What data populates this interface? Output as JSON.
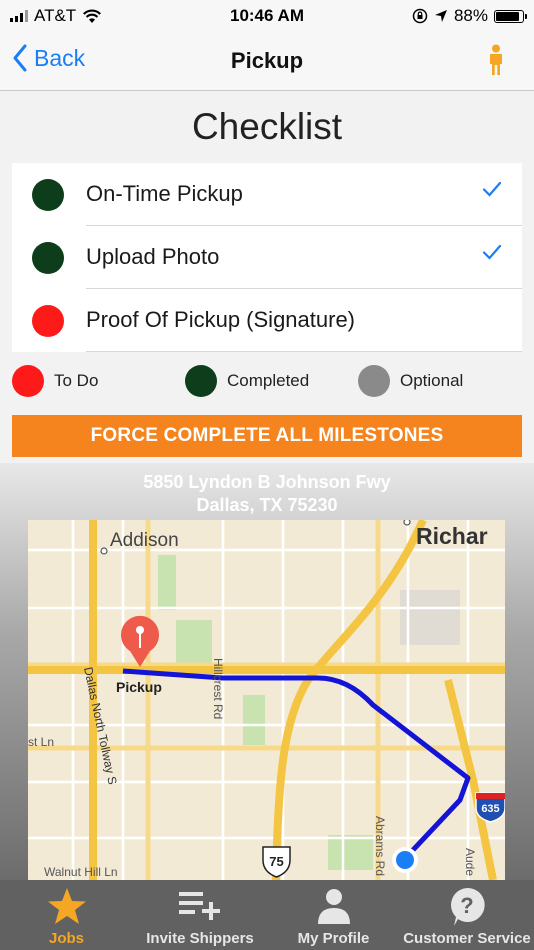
{
  "status": {
    "carrier": "AT&T",
    "time": "10:46 AM",
    "battery": "88%",
    "battery_level": 0.88
  },
  "nav": {
    "back_label": "Back",
    "title": "Pickup"
  },
  "checklist": {
    "title": "Checklist",
    "items": [
      {
        "label": "On-Time Pickup",
        "status_color": "#0d3d1b",
        "checked": true
      },
      {
        "label": "Upload Photo",
        "status_color": "#0d3d1b",
        "checked": true
      },
      {
        "label": "Proof Of Pickup (Signature)",
        "status_color": "#ff1a1a",
        "checked": false
      }
    ]
  },
  "legend": [
    {
      "label": "To Do",
      "color": "#ff1a1a"
    },
    {
      "label": "Completed",
      "color": "#0d3d1b"
    },
    {
      "label": "Optional",
      "color": "#8a8a8a"
    }
  ],
  "force_button": "FORCE COMPLETE ALL MILESTONES",
  "address": {
    "line1": "5850 Lyndon B Johnson Fwy",
    "line2": "Dallas, TX 75230"
  },
  "map": {
    "labels": {
      "addison": "Addison",
      "richardson": "Richar",
      "pickup": "Pickup",
      "tollway": "Dallas North Tollway S",
      "hillcrest": "Hillcrest Rd",
      "st_ln": "st Ln",
      "walnut": "Walnut Hill Ln",
      "abrams": "Abrams Rd",
      "aude": "Aude",
      "us75": "75",
      "i635": "635"
    }
  },
  "tabs": [
    {
      "label": "Jobs",
      "active": true
    },
    {
      "label": "Invite Shippers",
      "active": false
    },
    {
      "label": "My Profile",
      "active": false
    },
    {
      "label": "Customer Service",
      "active": false
    }
  ],
  "colors": {
    "accent_blue": "#1a7ef5",
    "orange": "#f5841f",
    "tab_active": "#f5a623",
    "route": "#1414d6"
  }
}
